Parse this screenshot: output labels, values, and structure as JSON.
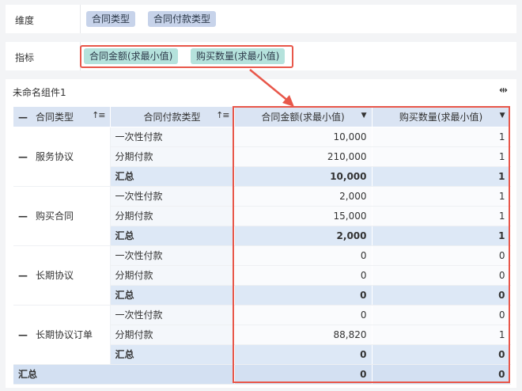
{
  "dimension_bar": {
    "label": "维度",
    "fields": [
      "合同类型",
      "合同付款类型"
    ]
  },
  "metric_bar": {
    "label": "指标",
    "fields": [
      "合同金额(求最小值)",
      "购买数量(求最小值)"
    ]
  },
  "widget": {
    "title": "未命名组件1",
    "resize_icon": "⇹"
  },
  "table": {
    "headers": [
      "合同类型",
      "合同付款类型",
      "合同金额(求最小值)",
      "购买数量(求最小值)"
    ],
    "collapse_glyph": "—",
    "sort_glyph": "↑≡",
    "caret_glyph": "▼",
    "groups": [
      {
        "name": "服务协议",
        "rows": [
          {
            "type": "一次性付款",
            "amount": "10,000",
            "qty": "1"
          },
          {
            "type": "分期付款",
            "amount": "210,000",
            "qty": "1"
          }
        ],
        "subtotal": {
          "label": "汇总",
          "amount": "10,000",
          "qty": "1"
        }
      },
      {
        "name": "购买合同",
        "rows": [
          {
            "type": "一次性付款",
            "amount": "2,000",
            "qty": "1"
          },
          {
            "type": "分期付款",
            "amount": "15,000",
            "qty": "1"
          }
        ],
        "subtotal": {
          "label": "汇总",
          "amount": "2,000",
          "qty": "1"
        }
      },
      {
        "name": "长期协议",
        "rows": [
          {
            "type": "一次性付款",
            "amount": "0",
            "qty": "0"
          },
          {
            "type": "分期付款",
            "amount": "0",
            "qty": "0"
          }
        ],
        "subtotal": {
          "label": "汇总",
          "amount": "0",
          "qty": "0"
        }
      },
      {
        "name": "长期协议订单",
        "rows": [
          {
            "type": "一次性付款",
            "amount": "0",
            "qty": "0"
          },
          {
            "type": "分期付款",
            "amount": "88,820",
            "qty": "1"
          }
        ],
        "subtotal": {
          "label": "汇总",
          "amount": "0",
          "qty": "0"
        }
      }
    ],
    "grand_total": {
      "label": "汇总",
      "amount": "0",
      "qty": "0"
    }
  },
  "colors": {
    "highlight": "#e8574a",
    "dimension_pill": "#c7d3ea",
    "metric_pill": "#b5e2dc",
    "header_bg": "#dae4f3"
  }
}
